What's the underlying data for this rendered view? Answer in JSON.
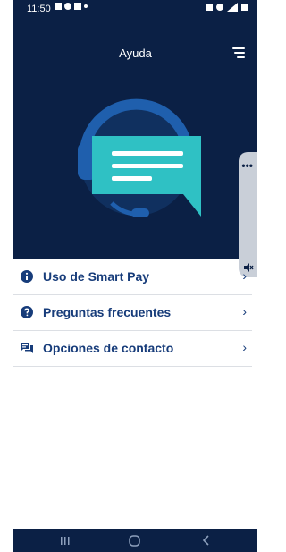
{
  "status_bar": {
    "time": "11:50"
  },
  "header": {
    "title": "Ayuda"
  },
  "menu": {
    "items": [
      {
        "label": "Uso de Smart Pay",
        "icon": "info-icon"
      },
      {
        "label": "Preguntas frecuentes",
        "icon": "question-icon"
      },
      {
        "label": "Opciones de contacto",
        "icon": "chat-icon"
      }
    ],
    "chevron": "›"
  },
  "side_panel": {
    "dots": "•••"
  },
  "colors": {
    "header_bg": "#0b2045",
    "accent": "#173c7a",
    "bubble": "#2fc1c4"
  }
}
